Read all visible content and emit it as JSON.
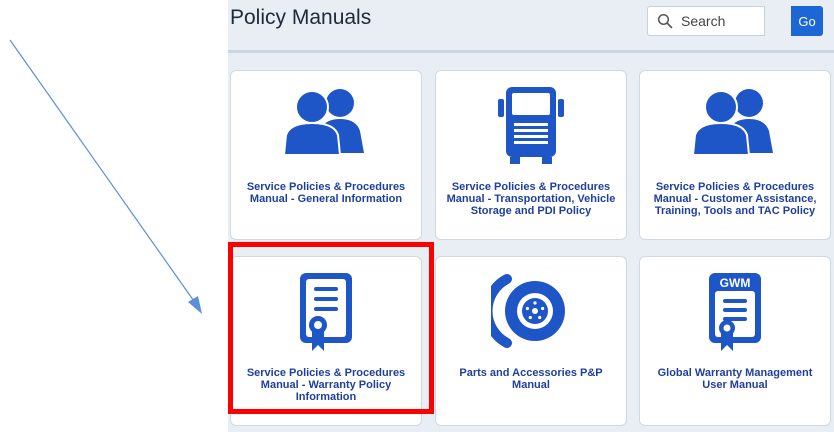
{
  "page": {
    "title": "Policy Manuals"
  },
  "search": {
    "placeholder": "Search",
    "value": "",
    "go_label": "Go"
  },
  "colors": {
    "accent": "#1d66d6",
    "icon_blue": "#1f56c7",
    "label_blue": "#1f3f9e",
    "highlight": "#ff0000",
    "arrow": "#5b8fd9"
  },
  "tiles": [
    {
      "label": "Service Policies & Procedures Manual - General Information",
      "icon": "people-icon"
    },
    {
      "label": "Service Policies & Procedures Manual - Transportation, Vehicle Storage and PDI Policy",
      "icon": "truck-icon"
    },
    {
      "label": "Service Policies & Procedures Manual - Customer Assistance, Training, Tools and TAC Policy",
      "icon": "people-icon"
    },
    {
      "label": "Service Policies & Procedures Manual - Warranty Policy Information",
      "icon": "certificate-icon",
      "highlighted": true
    },
    {
      "label": "Parts and Accessories P&P Manual",
      "icon": "brake-disc-icon"
    },
    {
      "label": "Global Warranty Management User Manual",
      "icon": "gwm-certificate-icon",
      "icon_text": "GWM"
    }
  ]
}
